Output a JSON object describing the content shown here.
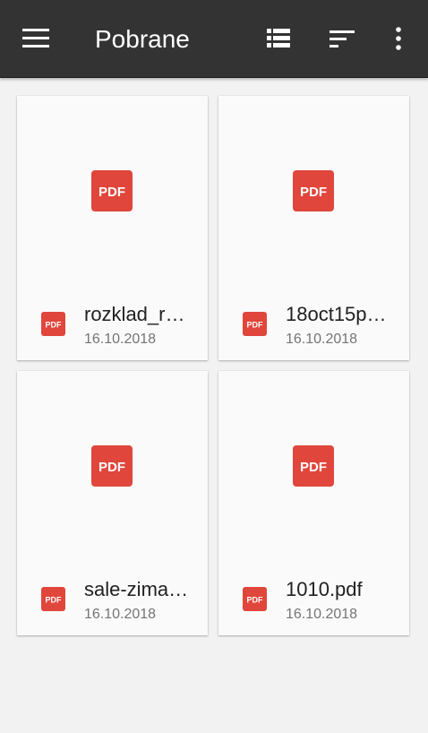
{
  "header": {
    "title": "Pobrane",
    "background": "#333333",
    "icons": {
      "menu": "hamburger-menu-icon",
      "view": "list-view-icon",
      "sort": "sort-icon",
      "more": "more-vert-icon"
    }
  },
  "files": [
    {
      "name": "rozklad_r…",
      "date": "16.10.2018",
      "type_icon": "pdf-icon"
    },
    {
      "name": "18oct15p…",
      "date": "16.10.2018",
      "type_icon": "pdf-icon"
    },
    {
      "name": "sale-zima…",
      "date": "16.10.2018",
      "type_icon": "pdf-icon"
    },
    {
      "name": "1010.pdf",
      "date": "16.10.2018",
      "type_icon": "pdf-icon"
    }
  ],
  "colors": {
    "pdf_red": "#e0463b",
    "background": "#f2f2f2",
    "card": "#fafafa"
  }
}
